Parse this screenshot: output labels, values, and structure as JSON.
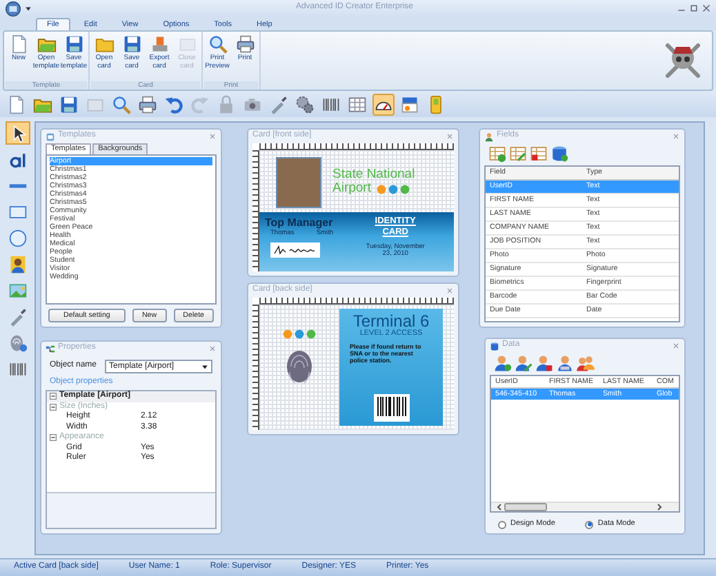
{
  "window": {
    "title": "Advanced ID Creator Enterprise"
  },
  "menu_tabs": [
    {
      "label": "File",
      "selected": true
    },
    {
      "label": "Edit",
      "selected": false
    },
    {
      "label": "View",
      "selected": false
    },
    {
      "label": "Options",
      "selected": false
    },
    {
      "label": "Tools",
      "selected": false
    },
    {
      "label": "Help",
      "selected": false
    }
  ],
  "ribbon": {
    "groups": [
      {
        "label": "Template",
        "buttons": [
          {
            "label": "New",
            "disabled": false
          },
          {
            "label": "Open template",
            "disabled": false
          },
          {
            "label": "Save template",
            "disabled": false
          }
        ]
      },
      {
        "label": "Card",
        "buttons": [
          {
            "label": "Open card",
            "disabled": false
          },
          {
            "label": "Save card",
            "disabled": false
          },
          {
            "label": "Export card",
            "disabled": false
          },
          {
            "label": "Close card",
            "disabled": true
          }
        ]
      },
      {
        "label": "Print",
        "buttons": [
          {
            "label": "Print Preview",
            "disabled": false
          },
          {
            "label": "Print",
            "disabled": false
          }
        ]
      }
    ]
  },
  "toolbar": [
    {
      "selected": false
    },
    {
      "selected": false
    },
    {
      "selected": false
    },
    {
      "selected": false
    },
    {
      "selected": false
    },
    {
      "selected": false
    },
    {
      "selected": false
    },
    {
      "selected": false
    },
    {
      "selected": false
    },
    {
      "selected": false
    },
    {
      "selected": false
    },
    {
      "selected": false
    },
    {
      "selected": false
    },
    {
      "selected": false
    },
    {
      "selected": true
    },
    {
      "selected": false
    },
    {
      "selected": false
    }
  ],
  "toolbox": [
    {
      "selected": true
    },
    {
      "selected": false
    },
    {
      "selected": false
    },
    {
      "selected": false
    },
    {
      "selected": false
    },
    {
      "selected": false
    },
    {
      "selected": false
    },
    {
      "selected": false
    },
    {
      "selected": false
    },
    {
      "selected": false
    }
  ],
  "templates_panel": {
    "title": "Templates",
    "tabs": [
      {
        "label": "Templates",
        "selected": true
      },
      {
        "label": "Backgrounds",
        "selected": false
      }
    ],
    "items": [
      {
        "label": "Airport",
        "selected": true
      },
      {
        "label": "Christmas1",
        "selected": false
      },
      {
        "label": "Christmas2",
        "selected": false
      },
      {
        "label": "Christmas3",
        "selected": false
      },
      {
        "label": "Christmas4",
        "selected": false
      },
      {
        "label": "Christmas5",
        "selected": false
      },
      {
        "label": "Community",
        "selected": false
      },
      {
        "label": "Festival",
        "selected": false
      },
      {
        "label": "Green Peace",
        "selected": false
      },
      {
        "label": "Health",
        "selected": false
      },
      {
        "label": "Medical",
        "selected": false
      },
      {
        "label": "People",
        "selected": false
      },
      {
        "label": "Student",
        "selected": false
      },
      {
        "label": "Visitor",
        "selected": false
      },
      {
        "label": "Wedding",
        "selected": false
      }
    ],
    "buttons": [
      "Default setting",
      "New",
      "Delete"
    ]
  },
  "properties_panel": {
    "title": "Properties",
    "object_name_label": "Object name",
    "object_name_value": "Template [Airport]",
    "link": "Object properties",
    "tree": [
      {
        "label": "Template [Airport]",
        "expanded": true,
        "children": [
          {
            "label": "Size (Inches)",
            "expanded": true,
            "children": [
              {
                "label": "Height",
                "value": "2.12"
              },
              {
                "label": "Width",
                "value": "3.38"
              }
            ]
          },
          {
            "label": "Appearance",
            "expanded": true,
            "children": [
              {
                "label": "Grid",
                "value": "Yes"
              },
              {
                "label": "Ruler",
                "value": "Yes"
              }
            ]
          }
        ]
      }
    ]
  },
  "card_front": {
    "title": "Card [front side]",
    "heading": "State National",
    "heading_2": "Airport",
    "job_title": "Top Manager",
    "first_name": "Thomas",
    "last_name": "Smith",
    "card_type": "IDENTITY CARD",
    "date": "Tuesday, November 23, 2010"
  },
  "card_back": {
    "title": "Card [back side]",
    "heading": "Terminal 6",
    "subheading": "LEVEL 2 ACCESS",
    "notice": "Please if found return to SNA or to the nearest police station."
  },
  "fields_panel": {
    "title": "Fields",
    "columns": [
      "Field",
      "Type"
    ],
    "rows": [
      {
        "field": "UserID",
        "type": "Text",
        "selected": true
      },
      {
        "field": "FIRST NAME",
        "type": "Text",
        "selected": false
      },
      {
        "field": "LAST NAME",
        "type": "Text",
        "selected": false
      },
      {
        "field": "COMPANY NAME",
        "type": "Text",
        "selected": false
      },
      {
        "field": "JOB POSITION",
        "type": "Text",
        "selected": false
      },
      {
        "field": "Photo",
        "type": "Photo",
        "selected": false
      },
      {
        "field": "Signature",
        "type": "Signature",
        "selected": false
      },
      {
        "field": "Biometrics",
        "type": "Fingerprint",
        "selected": false
      },
      {
        "field": "Barcode",
        "type": "Bar Code",
        "selected": false
      },
      {
        "field": "Due Date",
        "type": "Date",
        "selected": false
      }
    ]
  },
  "data_panel": {
    "title": "Data",
    "columns": [
      "UserID",
      "FIRST NAME",
      "LAST NAME",
      "COM"
    ],
    "rows": [
      {
        "cells": [
          "546-345-410",
          "Thomas",
          "Smith",
          "Glob"
        ],
        "selected": true
      }
    ],
    "modes": [
      {
        "label": "Design Mode",
        "selected": false
      },
      {
        "label": "Data Mode",
        "selected": true
      }
    ]
  },
  "status_bar": [
    "Active Card [back side]",
    "User Name: 1",
    "Role: Supervisor",
    "Designer: YES",
    "Printer: Yes"
  ]
}
